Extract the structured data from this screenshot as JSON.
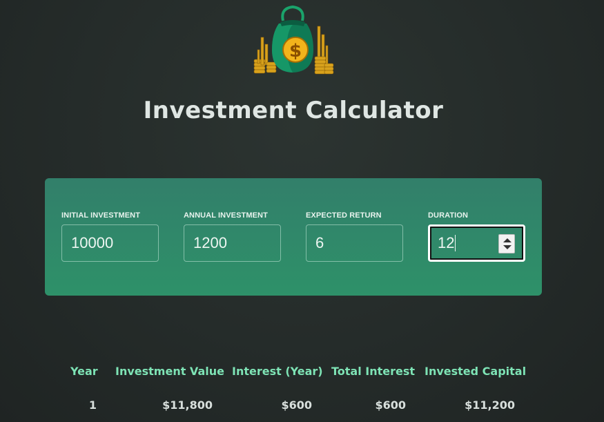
{
  "header": {
    "logo": "money-bag-logo",
    "title": "Investment Calculator"
  },
  "inputs": [
    {
      "label": "INITIAL INVESTMENT",
      "value": "10000"
    },
    {
      "label": "ANNUAL INVESTMENT",
      "value": "1200"
    },
    {
      "label": "EXPECTED RETURN",
      "value": "6"
    },
    {
      "label": "DURATION",
      "value": "12"
    }
  ],
  "results": {
    "headers": [
      "Year",
      "Investment Value",
      "Interest (Year)",
      "Total Interest",
      "Invested Capital"
    ],
    "rows": [
      [
        "1",
        "$11,800",
        "$600",
        "$600",
        "$11,200"
      ]
    ]
  },
  "colors": {
    "panel": "#2e8b6a",
    "header_text": "#7ee3b5",
    "background": "#262d2b"
  }
}
